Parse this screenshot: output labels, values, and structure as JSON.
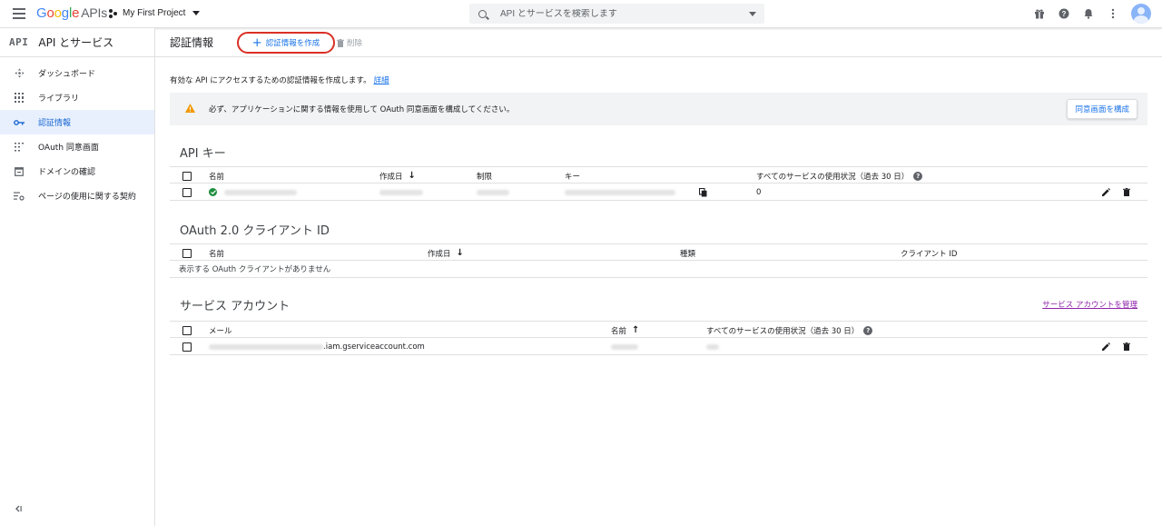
{
  "topbar": {
    "logo_google": "Google",
    "logo_apis": "APIs",
    "project_name": "My First Project",
    "search_placeholder": "API とサービスを検索します"
  },
  "sidebar": {
    "api_mark": "API",
    "title": "API とサービス",
    "items": [
      {
        "label": "ダッシュボード",
        "icon": "dashboard-icon",
        "active": false
      },
      {
        "label": "ライブラリ",
        "icon": "library-icon",
        "active": false
      },
      {
        "label": "認証情報",
        "icon": "key-icon",
        "active": true
      },
      {
        "label": "OAuth 同意画面",
        "icon": "oauth-consent-icon",
        "active": false
      },
      {
        "label": "ドメインの確認",
        "icon": "domain-verification-icon",
        "active": false
      },
      {
        "label": "ページの使用に関する契約",
        "icon": "page-usage-agreement-icon",
        "active": false
      }
    ],
    "collapse_label": "<|"
  },
  "main": {
    "title": "認証情報",
    "create_label": "認証情報を作成",
    "delete_label": "削除",
    "description": "有効な API にアクセスするための認証情報を作成します。",
    "description_link": "詳細",
    "banner_text": "必ず、アプリケーションに関する情報を使用して OAuth 同意画面を構成してください。",
    "banner_button": "同意画面を構成"
  },
  "api_keys": {
    "section_title": "API キー",
    "headers": {
      "name": "名前",
      "created": "作成日",
      "restriction": "制限",
      "key": "キー",
      "usage": "すべてのサービスの使用状況（過去 30 日）"
    },
    "rows": [
      {
        "usage": "0"
      }
    ]
  },
  "oauth": {
    "section_title": "OAuth 2.0 クライアント ID",
    "headers": {
      "name": "名前",
      "created": "作成日",
      "type": "種類",
      "client_id": "クライアント ID"
    },
    "empty_text": "表示する OAuth クライアントがありません"
  },
  "service_accounts": {
    "section_title": "サービス アカウント",
    "manage_link": "サービス アカウントを管理",
    "headers": {
      "email": "メール",
      "name": "名前",
      "usage": "すべてのサービスの使用状況（過去 30 日）"
    },
    "rows": [
      {
        "email_suffix": ".iam.gserviceaccount.com"
      }
    ]
  },
  "colors": {
    "accent": "#1a73e8",
    "highlight_ring": "#d93025",
    "active_bg": "#e8f0fe",
    "warning": "#f29900",
    "ok": "#1e8e3e",
    "link_visited": "#8e24aa"
  }
}
